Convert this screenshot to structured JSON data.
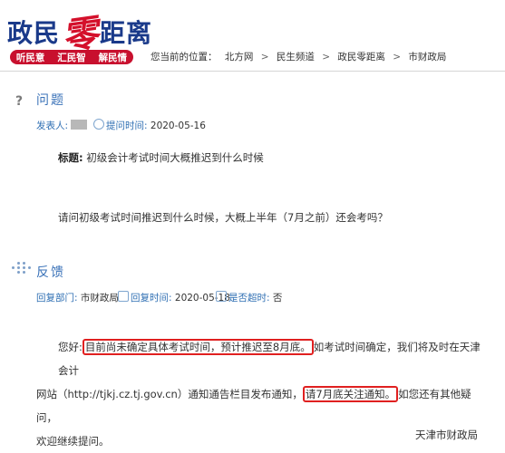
{
  "header": {
    "logo_part1": "政民",
    "logo_zero": "零",
    "logo_part2": "距离",
    "sub_items": [
      "听民意",
      "汇民智",
      "解民情"
    ],
    "breadcrumb_prefix": "您当前的位置：",
    "breadcrumb_items": [
      "北方网",
      "民生频道",
      "政民零距离",
      "市财政局"
    ],
    "breadcrumb_sep": ">"
  },
  "question": {
    "section_title": "问题",
    "sender_label": "发表人:",
    "time_label": "提问时间:",
    "time_value": "2020-05-16",
    "subject_label": "标题:",
    "subject_value": "初级会计考试时间大概推迟到什么时候",
    "body": "请问初级考试时间推迟到什么时候，大概上半年（7月之前）还会考吗？"
  },
  "feedback": {
    "section_title": "反馈",
    "dept_label": "回复部门:",
    "dept_value": "市财政局",
    "time_label": "回复时间:",
    "time_value": "2020-05-18",
    "overdue_label": "是否超时:",
    "overdue_value": "否",
    "greeting": "您好:",
    "highlight1": "目前尚未确定具体考试时间，预计推迟至8月底。",
    "text2": "如考试时间确定，我们将及时在天津会计",
    "line2_start": "网站（http://tjkj.cz.tj.gov.cn）通知通告栏目发布通知，",
    "highlight2": "请7月底关注通知。",
    "text3": "如您还有其他疑问，",
    "line3": "欢迎继续提问。",
    "signature": "天津市财政局"
  }
}
